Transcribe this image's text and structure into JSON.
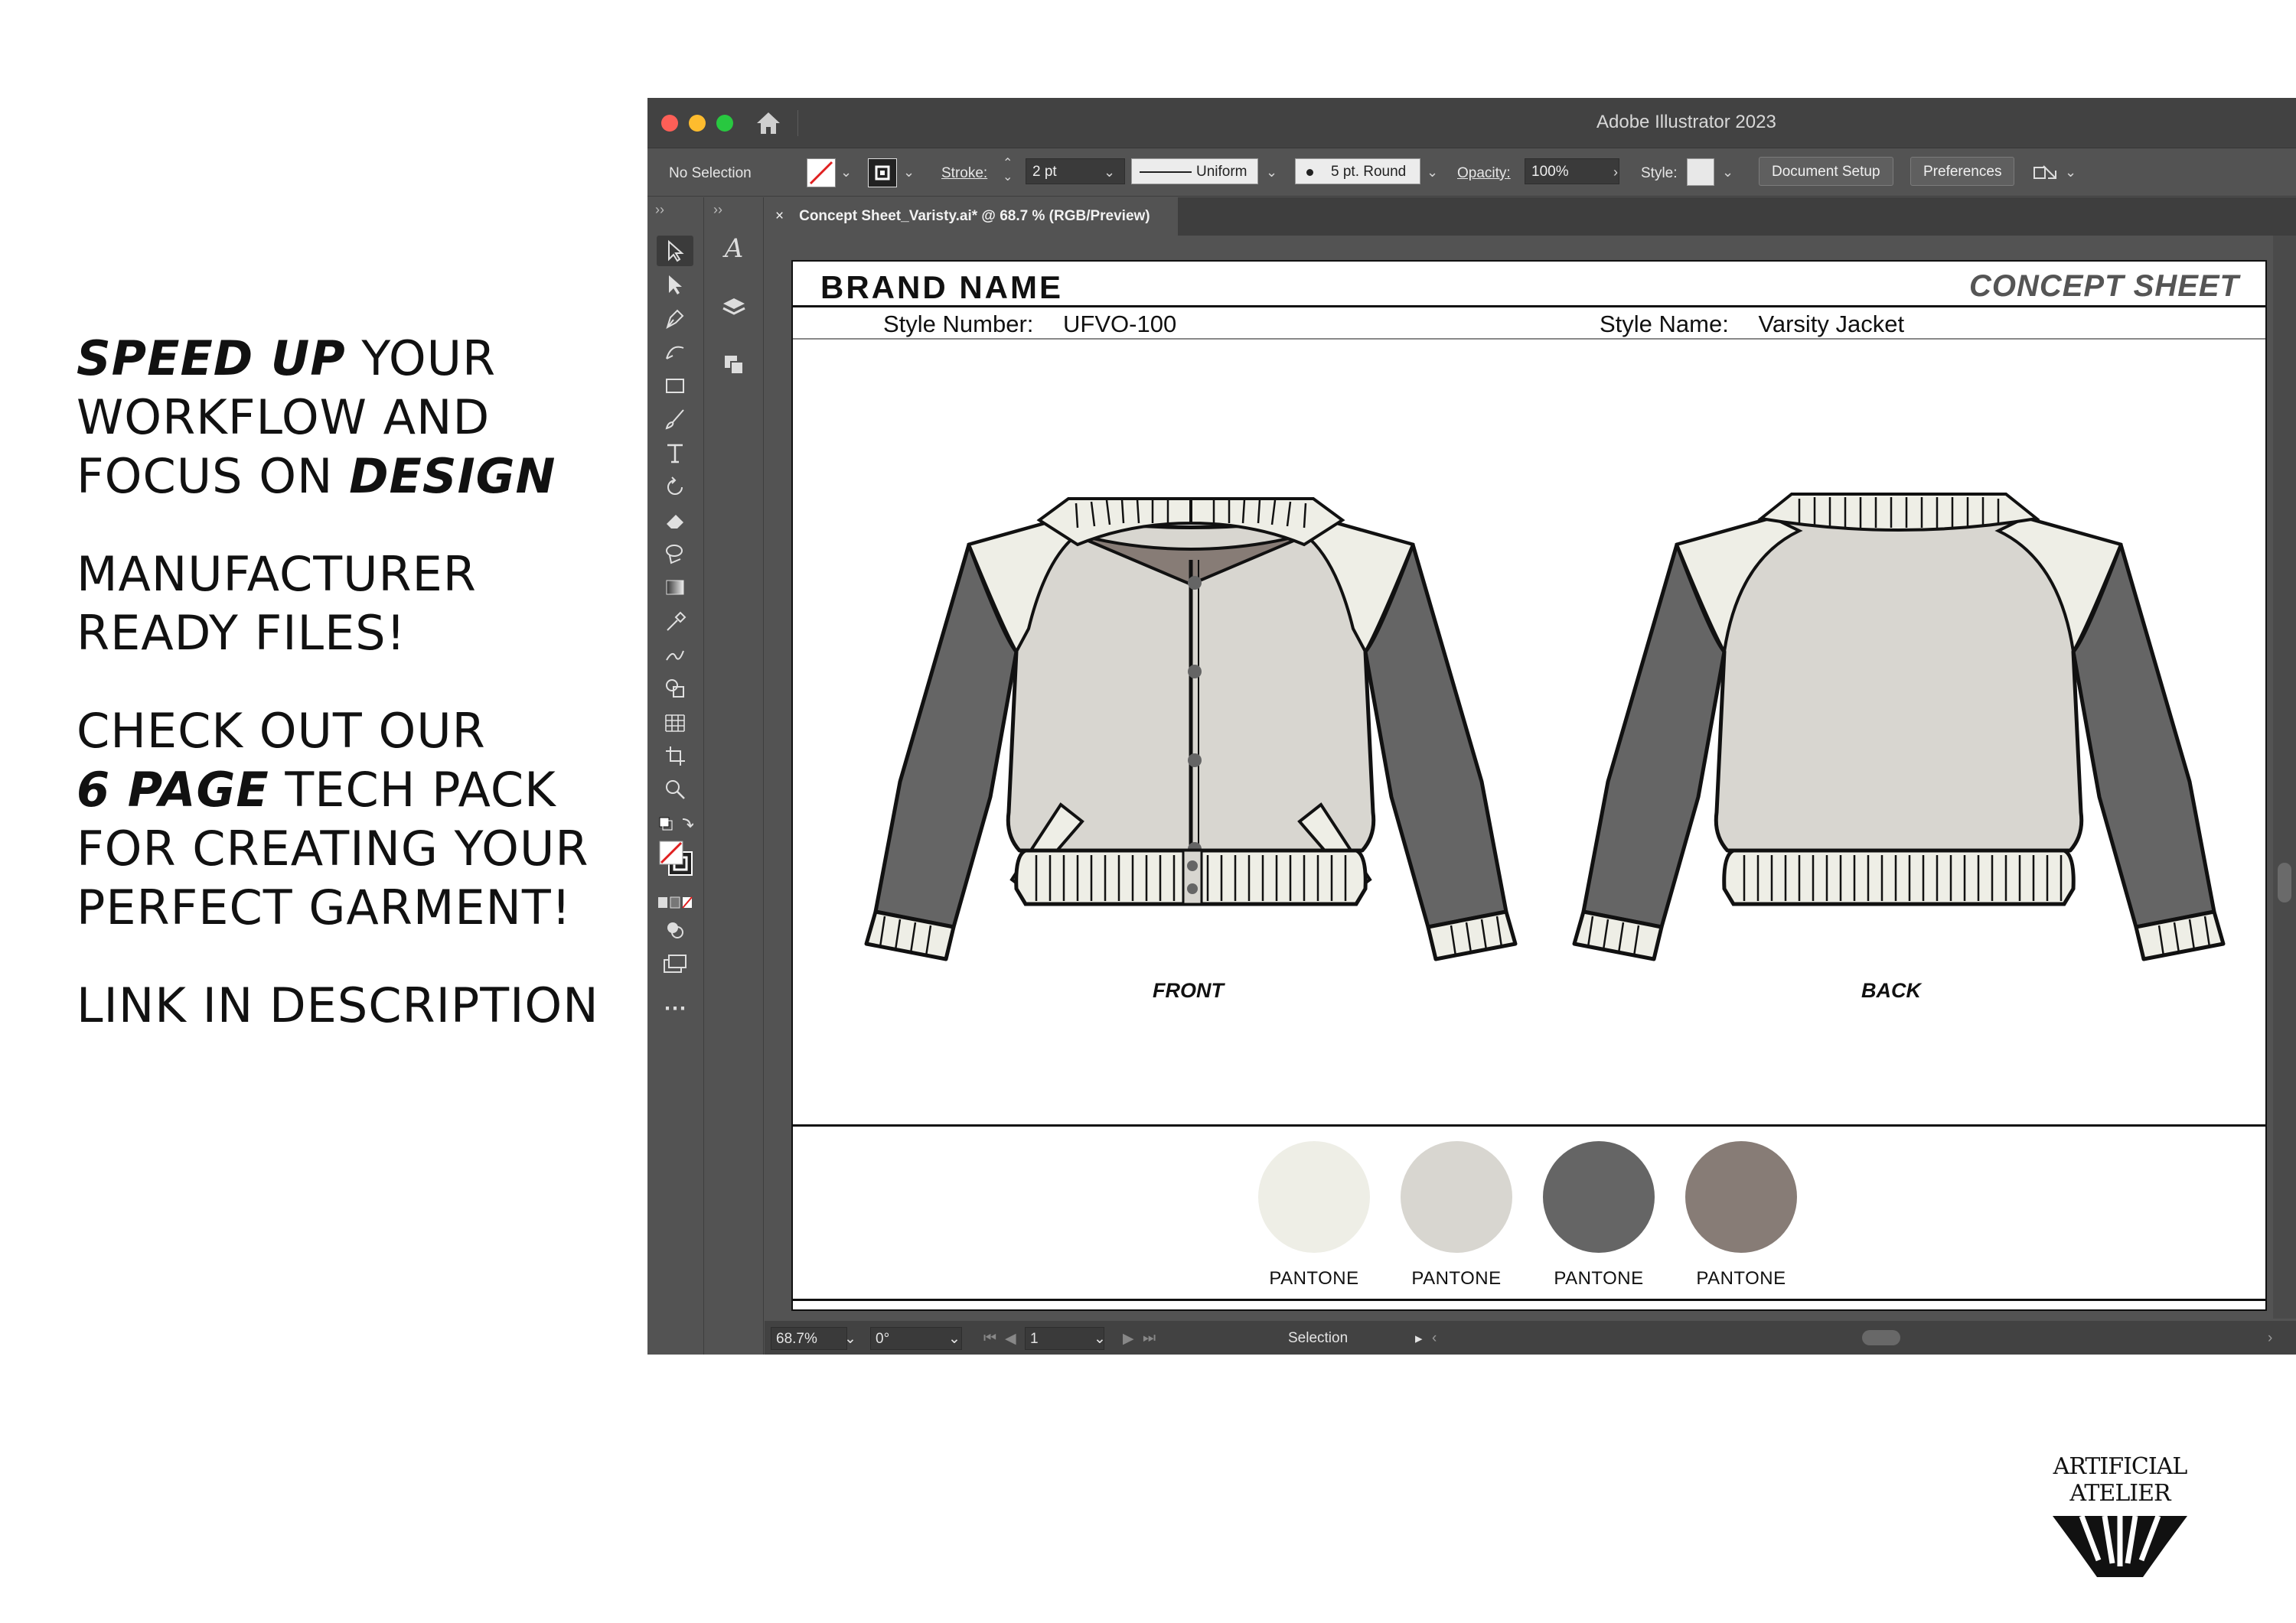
{
  "promo": {
    "p1_bold1": "SPEED UP",
    "p1_text1": " YOUR",
    "p1_line2": "WORKFLOW AND",
    "p1_text3": "FOCUS ON ",
    "p1_bold3": "DESIGN",
    "p2_line1": "MANUFACTURER",
    "p2_line2": "READY FILES!",
    "p3_line1": "CHECK OUT OUR",
    "p3_bold2": "6 PAGE",
    "p3_text2": " TECH PACK",
    "p3_line3": "FOR CREATING YOUR",
    "p3_line4": "PERFECT GARMENT!",
    "p4_line1": "LINK IN DESCRIPTION"
  },
  "brand": {
    "name": "ARTIFICIAL ATELIER"
  },
  "window": {
    "title": "Adobe Illustrator 2023"
  },
  "controlbar": {
    "selection": "No Selection",
    "stroke_label": "Stroke:",
    "stroke_value": "2 pt",
    "profile": "Uniform",
    "brush": "5 pt. Round",
    "opacity_label": "Opacity:",
    "opacity_value": "100%",
    "style_label": "Style:",
    "document_setup": "Document Setup",
    "preferences": "Preferences"
  },
  "tab": {
    "close": "×",
    "label": "Concept Sheet_Varisty.ai* @ 68.7 % (RGB/Preview)"
  },
  "artboard": {
    "brand": "BRAND NAME",
    "sheet_title": "CONCEPT SHEET",
    "style_number_label": "Style Number:",
    "style_number": "UFVO-100",
    "style_name_label": "Style Name:",
    "style_name": "Varsity Jacket",
    "front_label": "FRONT",
    "back_label": "BACK",
    "swatches": [
      {
        "label": "PANTONE",
        "color": "#eeeee6"
      },
      {
        "label": "PANTONE",
        "color": "#d8d6d0"
      },
      {
        "label": "PANTONE",
        "color": "#656565"
      },
      {
        "label": "PANTONE",
        "color": "#877c76"
      }
    ]
  },
  "garment_colors": {
    "body": "#d8d6d0",
    "trim": "#eeeee6",
    "sleeve": "#656565",
    "lining": "#877c76"
  },
  "statusbar": {
    "zoom": "68.7%",
    "rotation": "0°",
    "artboard_number": "1",
    "tool": "Selection"
  },
  "icons": [
    "home-icon",
    "selection-tool-icon",
    "direct-selection-icon",
    "pen-icon",
    "curvature-icon",
    "rectangle-icon",
    "paintbrush-icon",
    "type-icon",
    "rotate-icon",
    "eraser-icon",
    "lasso-icon",
    "gradient-icon",
    "eyedropper-icon",
    "blend-icon",
    "shape-builder-icon",
    "grid-icon",
    "artboard-icon",
    "zoom-icon",
    "fill-stroke-icon",
    "more-tools-icon",
    "character-icon",
    "layers-icon",
    "pathfinder-icon"
  ]
}
